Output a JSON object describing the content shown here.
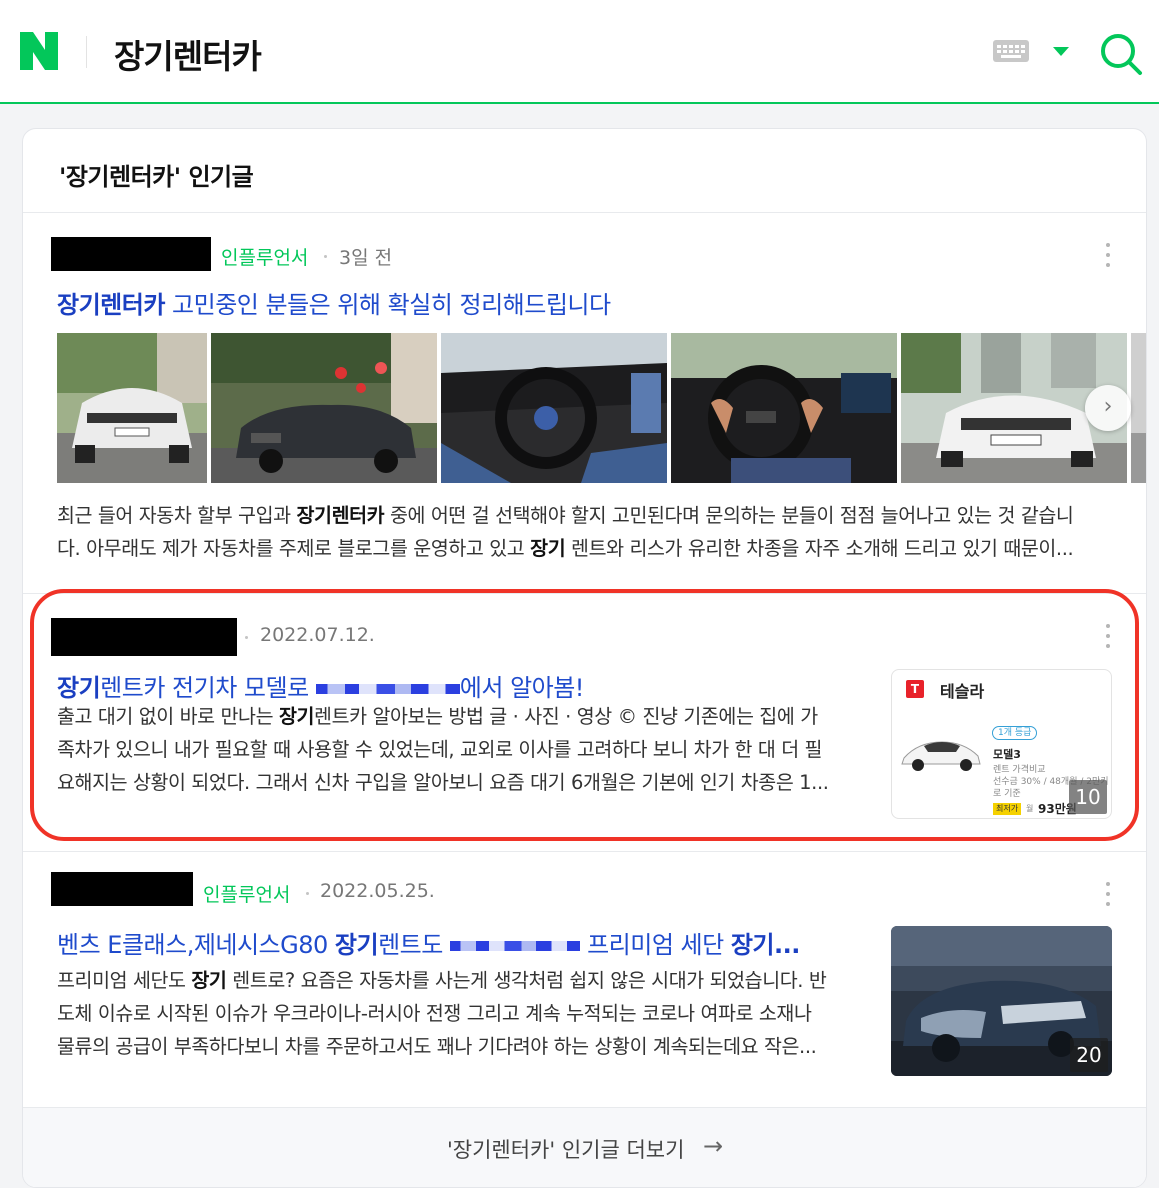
{
  "header": {
    "query": "장기렌터카",
    "logo_letter": "N"
  },
  "section": {
    "title": "'장기렌터카' 인기글",
    "more_label": "'장기렌터카' 인기글 더보기",
    "more_arrow": "→"
  },
  "posts": [
    {
      "badge": "인플루언서",
      "date": "3일 전",
      "title_bold": "장기렌터카",
      "title_rest": " 고민중인 분들은 위해 확실히 정리해드립니다",
      "desc_line1_a": "최근 들어 자동차 할부 구입과 ",
      "desc_line1_b": "장기렌터카",
      "desc_line1_c": " 중에 어떤 걸 선택해야 할지 고민된다며 문의하는 분들이 점점 늘어나고 있는 것 같습니",
      "desc_line2_a": "다. 아무래도 제가 자동차를 주제로 블로그를 운영하고 있고 ",
      "desc_line2_b": "장기",
      "desc_line2_c": " 렌트와 리스가 유리한 차종을 자주 소개해 드리고 있기 때문이...",
      "next_icon": "›"
    },
    {
      "date": "2022.07.12.",
      "title_bold": "장기",
      "title_mid": "렌트카 전기차 모델로 ",
      "title_end": "에서 알아봄!",
      "desc_line1_a": "출고 대기 없이 바로 만나는 ",
      "desc_line1_b": "장기",
      "desc_line1_c": "렌트카 알아보는 방법 글 · 사진 · 영상 © 진냥 기존에는 집에 가",
      "desc_line2": "족차가 있으니 내가 필요할 때 사용할 수 있었는데, 교외로 이사를 고려하다 보니 차가 한 대 더 필",
      "desc_line3": "요해지는 상황이 되었다. 그래서 신차 구입을 알아보니 요즘 대기 6개월은 기본에 인기 차종은 1...",
      "side": {
        "brand": "테슬라",
        "grade": "1개 등급",
        "model": "모델3",
        "sub1": "렌트 가격비교",
        "sub2": "선수금 30% / 48개월 / 2만키",
        "sub3": "로 기준",
        "lowest": "최저가",
        "month": "월",
        "price": "93만원",
        "count": "10"
      }
    },
    {
      "badge": "인플루언서",
      "date": "2022.05.25.",
      "title_a": "벤츠 E클래스,제네시스G80 ",
      "title_bold": "장기",
      "title_b": "렌트도 ",
      "title_c": " 프리미엄 세단 ",
      "title_bold2": "장기...",
      "desc_line1_a": "프리미엄 세단도 ",
      "desc_line1_b": "장기",
      "desc_line1_c": " 렌트로? 요즘은 자동차를 사는게 생각처럼 쉽지 않은 시대가 되었습니다. 반",
      "desc_line2": "도체 이슈로 시작된 이슈가 우크라이나-러시아 전쟁 그리고 계속 누적되는 코로나 여파로 소재나",
      "desc_line3": "물류의 공급이 부족하다보니 차를 주문하고서도 꽤나 기다려야 하는 상황이 계속되는데요 작은...",
      "count": "20"
    }
  ],
  "colors": {
    "naver_green": "#03c75a",
    "title_blue": "#1f4bcc",
    "highlight_red": "#f03327"
  },
  "icons": {
    "keyboard": "keyboard-icon",
    "dropdown": "caret-down-icon",
    "search": "search-icon",
    "more": "kebab-menu-icon",
    "next": "chevron-right-icon",
    "arrow": "arrow-right-icon"
  }
}
